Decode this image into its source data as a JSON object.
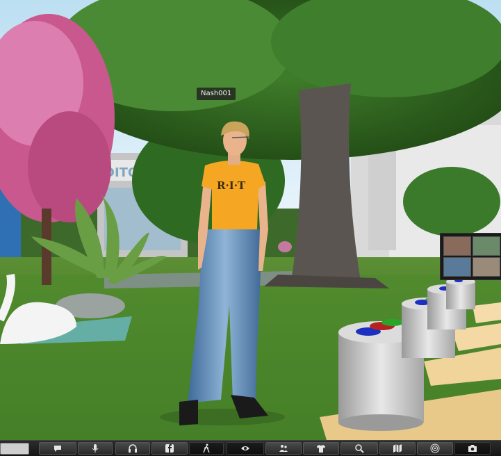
{
  "scene": {
    "avatar_name": "Nash001",
    "shirt_text": "R·I·T",
    "building_sign": "DITORIUM"
  },
  "toolbar": {
    "chat_input_value": "",
    "buttons": [
      {
        "id": "chat",
        "icon": "speech-bubble-icon"
      },
      {
        "id": "speak",
        "icon": "microphone-icon"
      },
      {
        "id": "voice",
        "icon": "headphones-icon"
      },
      {
        "id": "facebook",
        "icon": "facebook-icon"
      },
      {
        "id": "walk",
        "icon": "walking-person-icon"
      },
      {
        "id": "view",
        "icon": "eye-icon"
      },
      {
        "id": "people",
        "icon": "people-icon"
      },
      {
        "id": "appearance",
        "icon": "tshirt-icon"
      },
      {
        "id": "search",
        "icon": "magnifier-icon"
      },
      {
        "id": "map",
        "icon": "map-icon"
      },
      {
        "id": "destinations",
        "icon": "target-icon"
      },
      {
        "id": "snapshot",
        "icon": "camera-icon"
      }
    ]
  },
  "colors": {
    "toolbar_bg": "#1e1e1e",
    "shirt": "#f5a623",
    "jeans": "#5f8fbf",
    "grass": "#3f7a2a"
  }
}
